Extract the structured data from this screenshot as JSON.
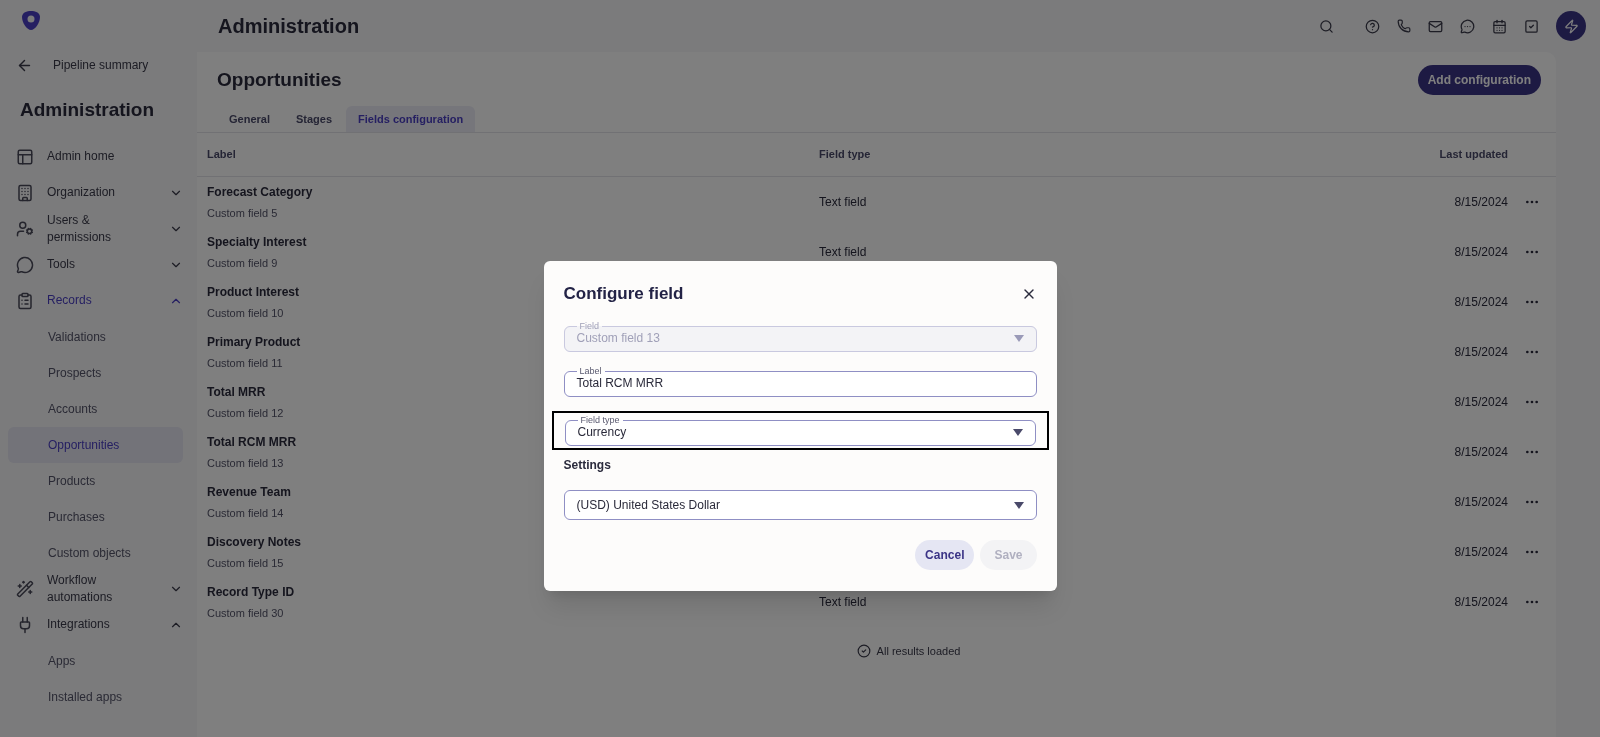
{
  "header": {
    "title": "Administration"
  },
  "sidebar": {
    "back_link": "Pipeline summary",
    "title": "Administration",
    "items": [
      {
        "kind": "link",
        "label": "Admin home",
        "active": false
      },
      {
        "kind": "group",
        "label": "Organization",
        "active": false,
        "expanded": false
      },
      {
        "kind": "group",
        "label": "Users & permissions",
        "active": false,
        "expanded": false
      },
      {
        "kind": "group",
        "label": "Tools",
        "active": false,
        "expanded": false
      },
      {
        "kind": "group",
        "label": "Records",
        "active": true,
        "expanded": true,
        "children": [
          {
            "label": "Validations",
            "selected": false
          },
          {
            "label": "Prospects",
            "selected": false
          },
          {
            "label": "Accounts",
            "selected": false
          },
          {
            "label": "Opportunities",
            "selected": true
          },
          {
            "label": "Products",
            "selected": false
          },
          {
            "label": "Purchases",
            "selected": false
          },
          {
            "label": "Custom objects",
            "selected": false
          }
        ]
      },
      {
        "kind": "group",
        "label": "Workflow automations",
        "active": false,
        "expanded": false
      },
      {
        "kind": "group",
        "label": "Integrations",
        "active": false,
        "expanded": true,
        "children": [
          {
            "label": "Apps",
            "selected": false
          },
          {
            "label": "Installed apps",
            "selected": false
          }
        ]
      }
    ]
  },
  "page": {
    "title": "Opportunities",
    "add_button": "Add configuration",
    "tabs": [
      {
        "label": "General",
        "selected": false
      },
      {
        "label": "Stages",
        "selected": false
      },
      {
        "label": "Fields configuration",
        "selected": true
      }
    ],
    "table": {
      "columns": [
        "Label",
        "Field type",
        "Last updated"
      ],
      "rows": [
        {
          "label": "Forecast Category",
          "subtitle": "Custom field 5",
          "field_type": "Text field",
          "last_updated": "8/15/2024"
        },
        {
          "label": "Specialty Interest",
          "subtitle": "Custom field 9",
          "field_type": "Text field",
          "last_updated": "8/15/2024"
        },
        {
          "label": "Product Interest",
          "subtitle": "Custom field 10",
          "last_updated": "8/15/2024"
        },
        {
          "label": "Primary Product",
          "subtitle": "Custom field 11",
          "last_updated": "8/15/2024"
        },
        {
          "label": "Total MRR",
          "subtitle": "Custom field 12",
          "last_updated": "8/15/2024"
        },
        {
          "label": "Total RCM MRR",
          "subtitle": "Custom field 13",
          "last_updated": "8/15/2024"
        },
        {
          "label": "Revenue Team",
          "subtitle": "Custom field 14",
          "last_updated": "8/15/2024"
        },
        {
          "label": "Discovery Notes",
          "subtitle": "Custom field 15",
          "last_updated": "8/15/2024"
        },
        {
          "label": "Record Type ID",
          "subtitle": "Custom field 30",
          "field_type": "Text field",
          "last_updated": "8/15/2024"
        }
      ]
    },
    "footer": "All results loaded"
  },
  "dialog": {
    "title": "Configure field",
    "fields": [
      {
        "kind": "select",
        "label": "Field",
        "value": "Custom field 13",
        "disabled": true,
        "highlighted": false
      },
      {
        "kind": "text",
        "label": "Label",
        "value": "Total RCM MRR",
        "disabled": false,
        "highlighted": false
      },
      {
        "kind": "select",
        "label": "Field type",
        "value": "Currency",
        "disabled": false,
        "highlighted": true
      }
    ],
    "settings_title": "Settings",
    "settings_fields": [
      {
        "kind": "select",
        "value": "(USD) United States Dollar",
        "disabled": false,
        "highlighted": false
      }
    ],
    "buttons": [
      {
        "label": "Cancel",
        "disabled": false
      },
      {
        "label": "Save",
        "disabled": true
      }
    ]
  }
}
